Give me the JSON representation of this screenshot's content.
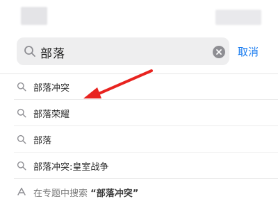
{
  "search": {
    "query": "部落",
    "cancel_label": "取消"
  },
  "suggestions": [
    {
      "label": "部落冲突",
      "icon": "search-icon"
    },
    {
      "label": "部落荣耀",
      "icon": "search-icon"
    },
    {
      "label": "部落",
      "icon": "search-icon"
    },
    {
      "label": "部落冲突:皇室战争",
      "icon": "search-icon"
    }
  ],
  "topic_search": {
    "prefix": "在专题中搜索",
    "term": "“部落冲突”",
    "icon": "app-store-icon"
  },
  "colors": {
    "accent": "#1b7df0",
    "annotation_arrow": "#e8231f"
  }
}
